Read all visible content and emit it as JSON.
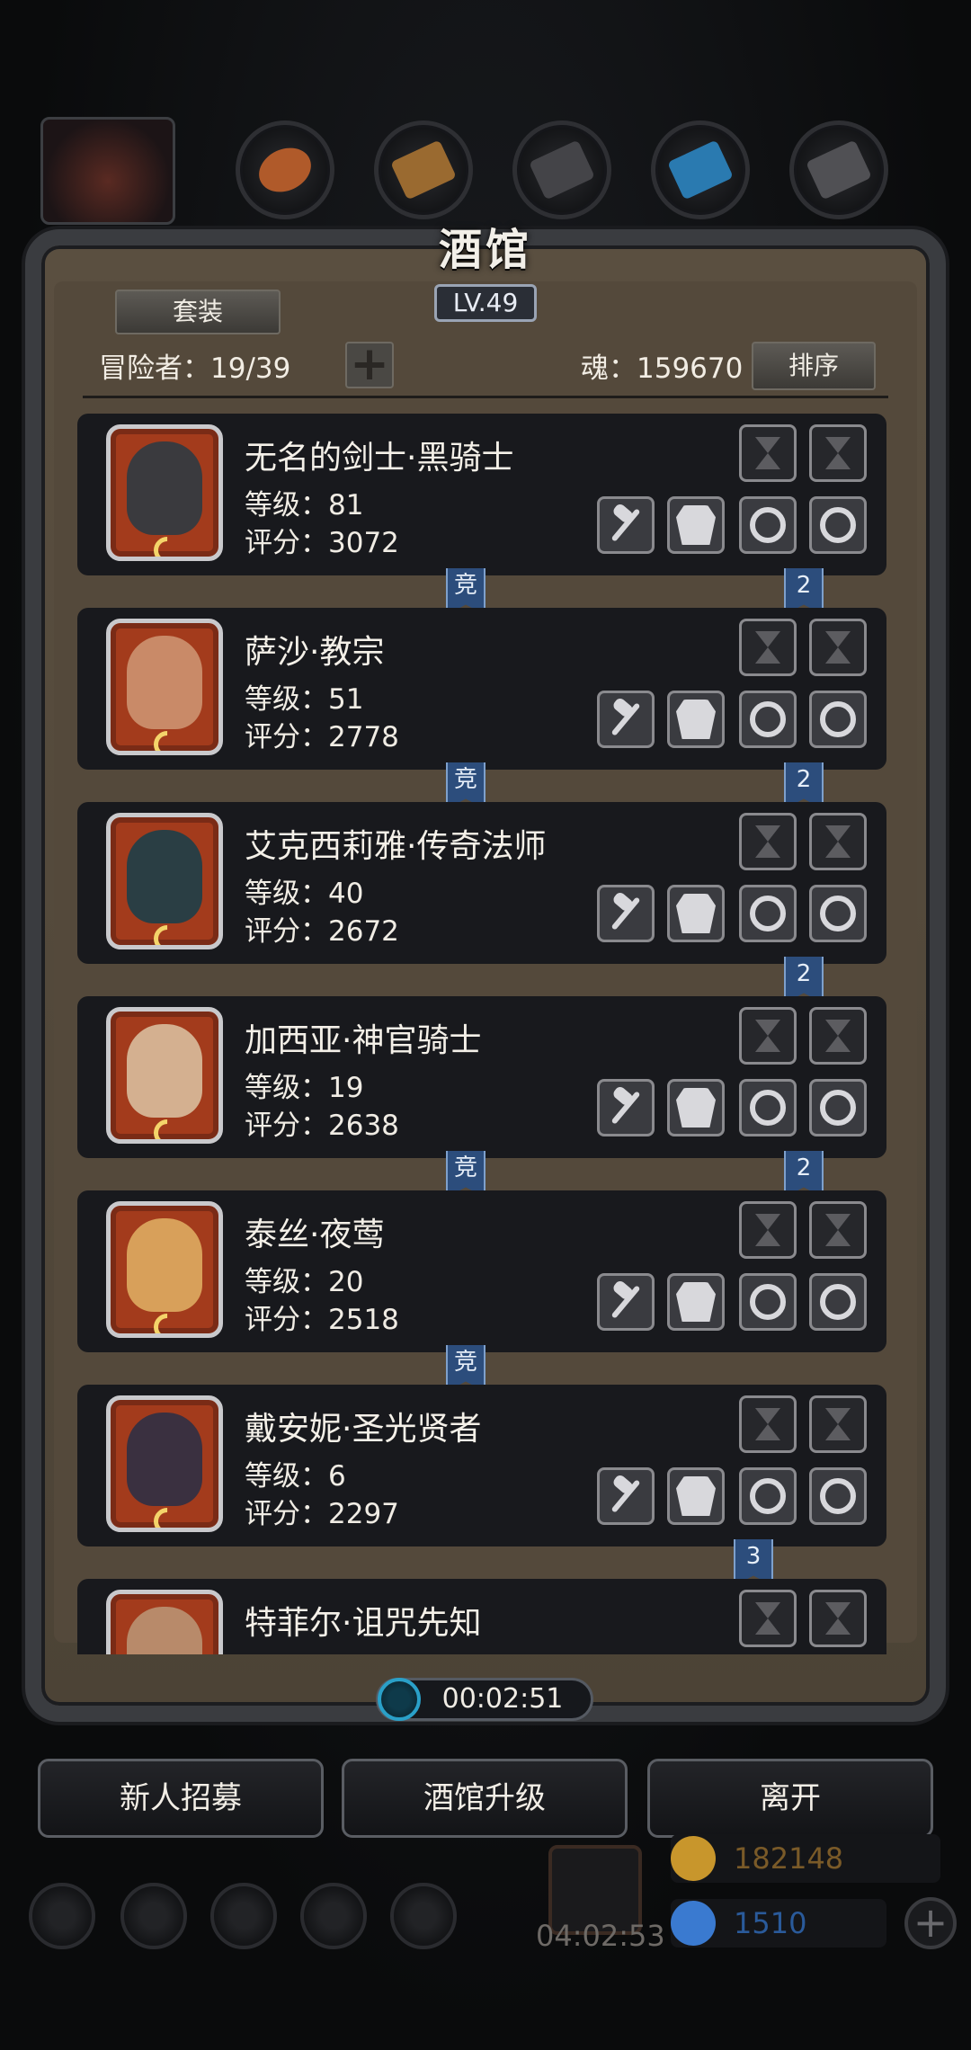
{
  "header": {
    "title": "酒馆",
    "level": "LV.49",
    "set_button": "套装",
    "adventurers_label": "冒险者：19/39",
    "soul_label": "魂：159670",
    "sort_button": "排序"
  },
  "tabs": [
    {
      "icon": "adventurer-portrait-icon"
    },
    {
      "icon": "ore-icon",
      "color": "#b05a2a"
    },
    {
      "icon": "wood-planks-icon",
      "color": "#9a6a30"
    },
    {
      "icon": "iron-ingot-icon",
      "color": "#444448"
    },
    {
      "icon": "crystal-icon",
      "color": "#2a7ab0"
    },
    {
      "icon": "steel-ingot-icon",
      "color": "#505054"
    }
  ],
  "adventurers": [
    {
      "name": "无名的剑士·黑骑士",
      "level": "等级：81",
      "score": "评分：3072",
      "weapon": "sword-icon",
      "badge_left": "竞",
      "badge_right": "2",
      "face": "#3a3a3e"
    },
    {
      "name": "萨沙·教宗",
      "level": "等级：51",
      "score": "评分：2778",
      "weapon": "mace-icon",
      "badge_left": "竞",
      "badge_right": "2",
      "face": "#c98a68"
    },
    {
      "name": "艾克西莉雅·传奇法师",
      "level": "等级：40",
      "score": "评分：2672",
      "weapon": "staff-icon",
      "badge_left": "",
      "badge_right": "2",
      "face": "#2a3e44"
    },
    {
      "name": "加西亚·神官骑士",
      "level": "等级：19",
      "score": "评分：2638",
      "weapon": "mace-icon",
      "badge_left": "竞",
      "badge_right": "2",
      "face": "#d4b090"
    },
    {
      "name": "泰丝·夜莺",
      "level": "等级：20",
      "score": "评分：2518",
      "weapon": "dagger-icon",
      "badge_left": "竞",
      "badge_right": "",
      "face": "#d8a05a"
    },
    {
      "name": "戴安妮·圣光贤者",
      "level": "等级：6",
      "score": "评分：2297",
      "weapon": "mace-icon",
      "badge_left": "",
      "badge_right": "3",
      "face": "#3a3040"
    },
    {
      "name": "特菲尔·诅咒先知",
      "level": "",
      "score": "",
      "weapon": "",
      "badge_left": "",
      "badge_right": "",
      "face": "#b88a6a"
    }
  ],
  "timer": "00:02:51",
  "buttons": {
    "recruit": "新人招募",
    "upgrade": "酒馆升级",
    "leave": "离开"
  },
  "footer": {
    "gift_timer": "04:02:53",
    "gold": "182148",
    "gems": "1510",
    "gold_color": "#c8962c",
    "gem_color": "#3a7ad0",
    "icons": [
      "settings-icon",
      "achievement-icon",
      "codex-icon",
      "mail-icon",
      "inventory-icon"
    ]
  }
}
